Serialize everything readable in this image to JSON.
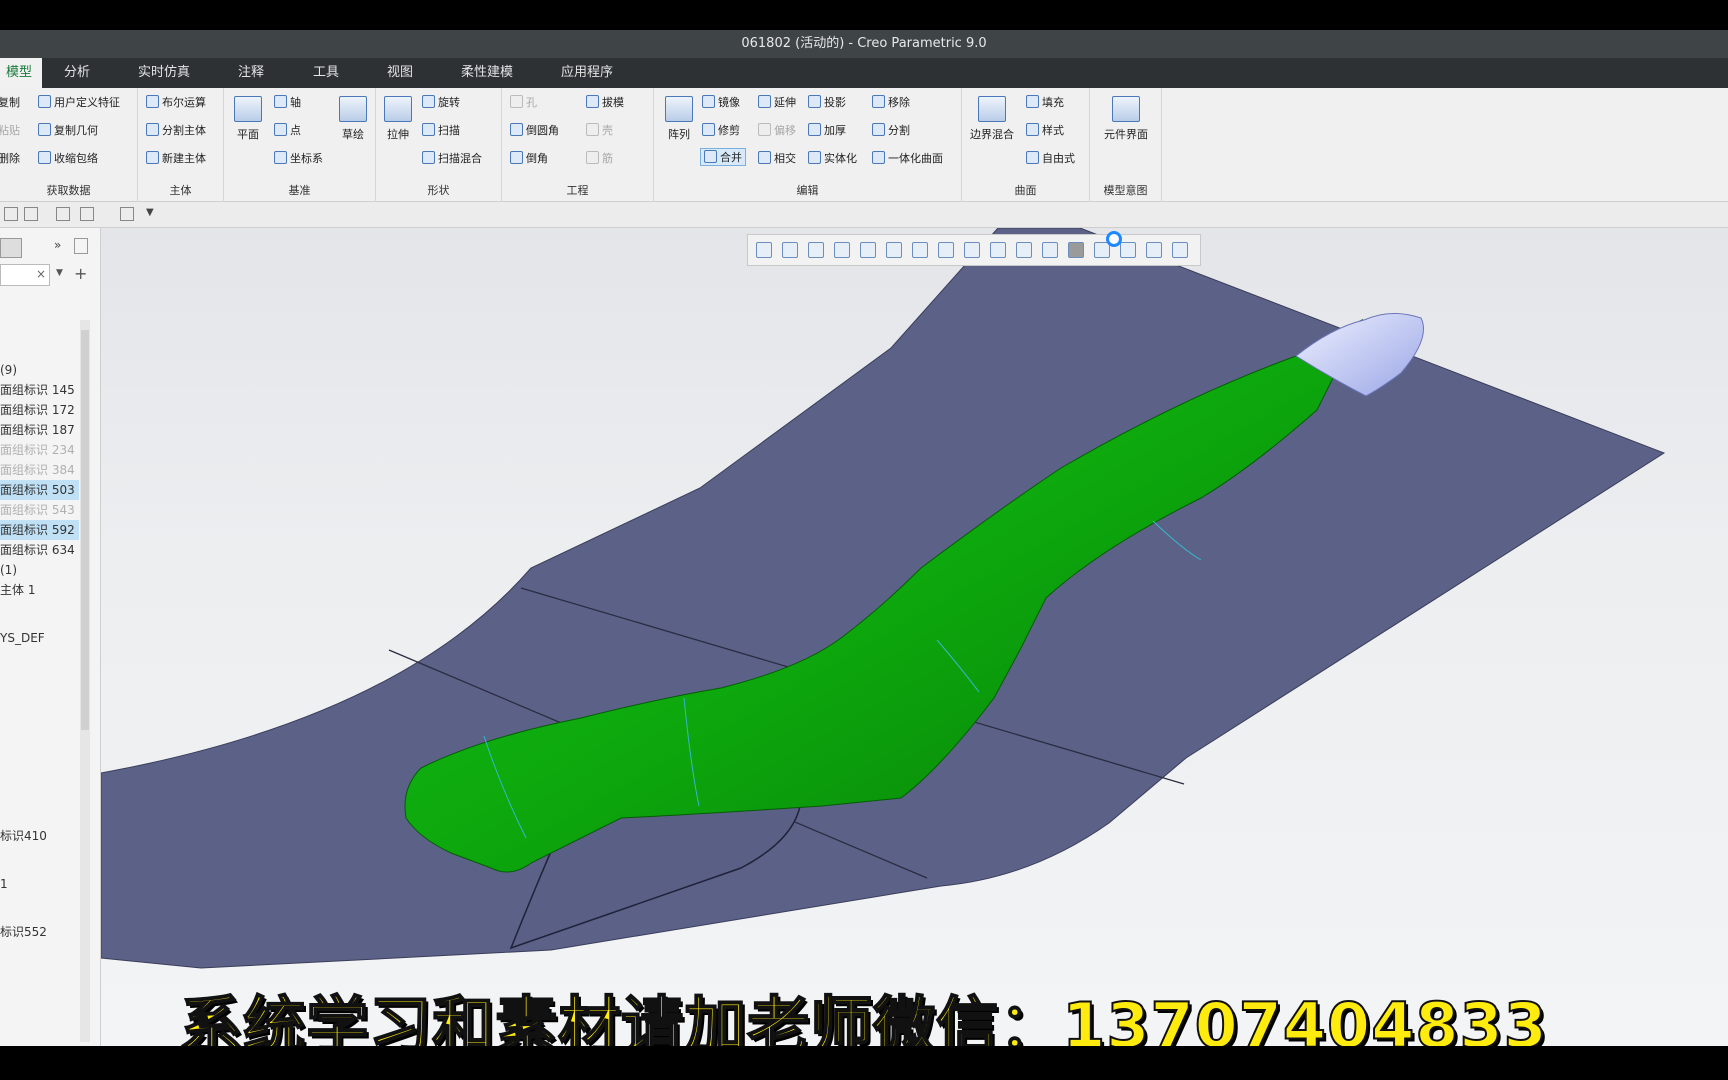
{
  "window": {
    "title": "061802 (活动的) - Creo Parametric 9.0"
  },
  "menu": {
    "tabs": [
      "模型",
      "分析",
      "实时仿真",
      "注释",
      "工具",
      "视图",
      "柔性建模",
      "应用程序"
    ]
  },
  "ribbon": {
    "get_data": {
      "items": [
        "复制",
        "用户定义特征",
        "复制几何",
        "收缩包络",
        "粘贴",
        "删除"
      ],
      "label": "获取数据"
    },
    "body": {
      "items": [
        "布尔运算",
        "分割主体",
        "新建主体"
      ],
      "label": "主体"
    },
    "datum": {
      "plane": "平面",
      "axis": "轴",
      "point": "点",
      "csys": "坐标系",
      "sketch": "草绘",
      "label": "基准"
    },
    "shapes": {
      "extrude": "拉伸",
      "revolve": "旋转",
      "sweep": "扫描",
      "swept_blend": "扫描混合",
      "label": "形状"
    },
    "engineering": {
      "hole": "孔",
      "draft": "拔模",
      "round": "倒圆角",
      "shell": "壳",
      "chamfer": "倒角",
      "rib": "筋",
      "label": "工程"
    },
    "editing": {
      "pattern": "阵列",
      "mirror": "镜像",
      "extend": "延伸",
      "project": "投影",
      "remove": "移除",
      "trim": "修剪",
      "offset": "偏移",
      "thicken": "加厚",
      "split": "分割",
      "merge": "合并",
      "intersect": "相交",
      "solidify": "实体化",
      "unify": "一体化曲面",
      "label": "编辑"
    },
    "surfaces": {
      "boundary": "边界混合",
      "fill": "填充",
      "style": "样式",
      "freestyle": "自由式",
      "label": "曲面"
    },
    "model_intent": {
      "component_interface": "元件界面",
      "label": "模型意图"
    }
  },
  "model_tree": {
    "search_clear": "×",
    "items": [
      {
        "text": "(9)",
        "state": "normal"
      },
      {
        "text": "面组标识 145",
        "state": "normal"
      },
      {
        "text": "面组标识 172",
        "state": "normal"
      },
      {
        "text": "面组标识 187",
        "state": "normal"
      },
      {
        "text": "面组标识 234",
        "state": "dim"
      },
      {
        "text": "面组标识 384",
        "state": "dim"
      },
      {
        "text": "面组标识 503",
        "state": "selected"
      },
      {
        "text": "面组标识 543",
        "state": "dim"
      },
      {
        "text": "面组标识 592",
        "state": "selected"
      },
      {
        "text": "面组标识 634",
        "state": "normal"
      },
      {
        "text": "(1)",
        "state": "normal"
      },
      {
        "text": "主体 1",
        "state": "normal"
      },
      {
        "text": "YS_DEF",
        "state": "normal"
      },
      {
        "text": "标识410",
        "state": "normal"
      },
      {
        "text": "1",
        "state": "normal"
      },
      {
        "text": "标识552",
        "state": "normal"
      }
    ]
  },
  "caption": {
    "text": "系统学习和素材请加老师微信：13707404833"
  },
  "colors": {
    "surface": "#5c6188",
    "body": "#18a018",
    "accent": "#1a7a3c",
    "caption": "#ffec0e"
  }
}
